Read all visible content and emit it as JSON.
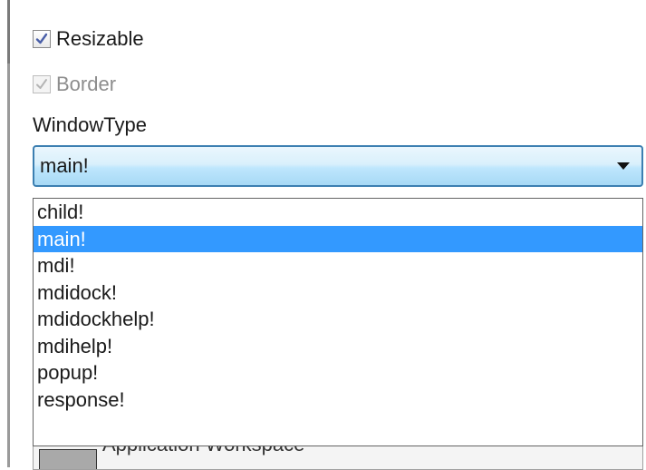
{
  "properties": {
    "resizable": {
      "label": "Resizable",
      "checked": true,
      "enabled": true
    },
    "border": {
      "label": "Border",
      "checked": true,
      "enabled": false
    },
    "window_type": {
      "label": "WindowType",
      "value": "main!",
      "options": [
        "child!",
        "main!",
        "mdi!",
        "mdidock!",
        "mdidockhelp!",
        "mdihelp!",
        "popup!",
        "response!"
      ],
      "selected_index": 1
    },
    "behind_control": {
      "text": "Application Workspace"
    }
  },
  "colors": {
    "selection": "#3399ff",
    "combo_border": "#3c7fb1",
    "check_mark": "#4a5fa8",
    "disabled_text": "#8d8d8d"
  },
  "icons": {
    "checkbox_mark": "check-icon",
    "combo_arrow": "chevron-down-icon"
  }
}
